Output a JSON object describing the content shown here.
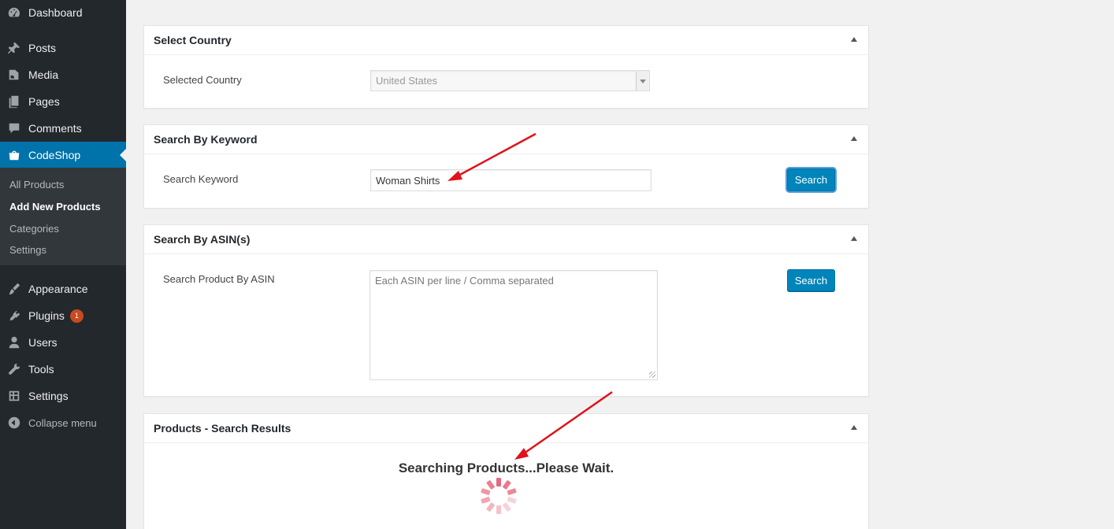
{
  "sidebar": {
    "menu": [
      {
        "label": "Dashboard",
        "icon": "dashboard-icon"
      },
      {
        "label": "Posts",
        "icon": "pin-icon"
      },
      {
        "label": "Media",
        "icon": "media-icon"
      },
      {
        "label": "Pages",
        "icon": "pages-icon"
      },
      {
        "label": "Comments",
        "icon": "comment-icon"
      },
      {
        "label": "CodeShop",
        "icon": "shop-icon"
      },
      {
        "label": "Appearance",
        "icon": "brush-icon"
      },
      {
        "label": "Plugins",
        "icon": "plugin-icon",
        "badge": "1"
      },
      {
        "label": "Users",
        "icon": "user-icon"
      },
      {
        "label": "Tools",
        "icon": "wrench-icon"
      },
      {
        "label": "Settings",
        "icon": "settings-icon"
      }
    ],
    "submenu": [
      "All Products",
      "Add New Products",
      "Categories",
      "Settings"
    ],
    "collapse_label": "Collapse menu"
  },
  "country": {
    "title": "Select Country",
    "label": "Selected Country",
    "value": "United States"
  },
  "keyword": {
    "title": "Search By Keyword",
    "label": "Search Keyword",
    "value": "Woman Shirts",
    "button": "Search"
  },
  "asin": {
    "title": "Search By ASIN(s)",
    "label": "Search Product By ASIN",
    "placeholder": "Each ASIN per line / Comma separated",
    "button": "Search"
  },
  "results": {
    "title": "Products - Search Results",
    "status": "Searching Products...Please Wait."
  },
  "colors": {
    "sidebar": "#23282d",
    "active": "#0073aa",
    "button": "#0085ba",
    "annotation": "#e0121b",
    "spinner": "#e8697f"
  }
}
